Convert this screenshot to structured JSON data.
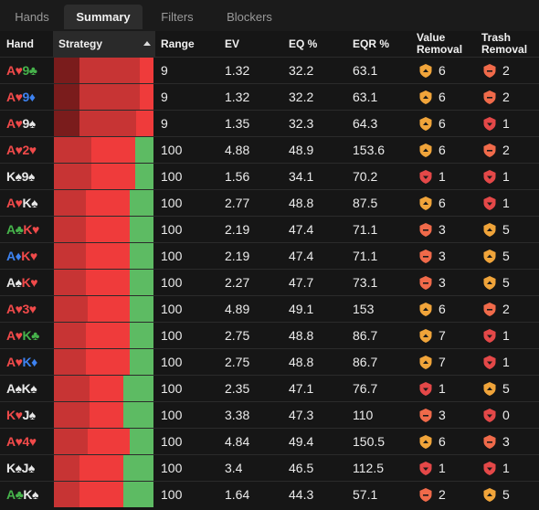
{
  "tabs": [
    "Hands",
    "Summary",
    "Filters",
    "Blockers"
  ],
  "active_tab": 1,
  "columns": {
    "hand": "Hand",
    "strategy": "Strategy",
    "range": "Range",
    "ev": "EV",
    "eq": "EQ %",
    "eqr": "EQR %",
    "value_removal_1": "Value",
    "value_removal_2": "Removal",
    "trash_removal_1": "Trash",
    "trash_removal_2": "Removal"
  },
  "colors": {
    "suit_red": "#f04a4a",
    "suit_white": "#e8e8e8",
    "suit_green": "#46b34b",
    "suit_blue": "#3d82f0",
    "dark_red": "#7a1c1c",
    "mid_red": "#c73434",
    "red": "#ef3b3b",
    "green": "#5dbb63",
    "badge_orange": "#f0a43a",
    "badge_red": "#e44848",
    "badge_coral": "#f06a4a"
  },
  "rows": [
    {
      "hand": [
        {
          "r": "A",
          "s": "♥",
          "c": "suit_red"
        },
        {
          "r": "9",
          "s": "♣",
          "c": "suit_green"
        }
      ],
      "strategy": [
        {
          "color": "dark_red",
          "frac": 0.26
        },
        {
          "color": "mid_red",
          "frac": 0.6
        },
        {
          "color": "red",
          "frac": 0.14
        }
      ],
      "range": "9",
      "ev": "1.32",
      "eq": "32.2",
      "eqr": "63.1",
      "vr": {
        "icon": "badge_orange",
        "val": "6"
      },
      "tr": {
        "icon": "badge_coral",
        "val": "2"
      }
    },
    {
      "hand": [
        {
          "r": "A",
          "s": "♥",
          "c": "suit_red"
        },
        {
          "r": "9",
          "s": "♦",
          "c": "suit_blue"
        }
      ],
      "strategy": [
        {
          "color": "dark_red",
          "frac": 0.26
        },
        {
          "color": "mid_red",
          "frac": 0.6
        },
        {
          "color": "red",
          "frac": 0.14
        }
      ],
      "range": "9",
      "ev": "1.32",
      "eq": "32.2",
      "eqr": "63.1",
      "vr": {
        "icon": "badge_orange",
        "val": "6"
      },
      "tr": {
        "icon": "badge_coral",
        "val": "2"
      }
    },
    {
      "hand": [
        {
          "r": "A",
          "s": "♥",
          "c": "suit_red"
        },
        {
          "r": "9",
          "s": "♠",
          "c": "suit_white"
        }
      ],
      "strategy": [
        {
          "color": "dark_red",
          "frac": 0.26
        },
        {
          "color": "mid_red",
          "frac": 0.57
        },
        {
          "color": "red",
          "frac": 0.17
        }
      ],
      "range": "9",
      "ev": "1.35",
      "eq": "32.3",
      "eqr": "64.3",
      "vr": {
        "icon": "badge_orange",
        "val": "6"
      },
      "tr": {
        "icon": "badge_red",
        "val": "1"
      }
    },
    {
      "hand": [
        {
          "r": "A",
          "s": "♥",
          "c": "suit_red"
        },
        {
          "r": "2",
          "s": "♥",
          "c": "suit_red"
        }
      ],
      "strategy": [
        {
          "color": "mid_red",
          "frac": 0.38
        },
        {
          "color": "red",
          "frac": 0.44
        },
        {
          "color": "green",
          "frac": 0.18
        }
      ],
      "range": "100",
      "ev": "4.88",
      "eq": "48.9",
      "eqr": "153.6",
      "vr": {
        "icon": "badge_orange",
        "val": "6"
      },
      "tr": {
        "icon": "badge_coral",
        "val": "2"
      }
    },
    {
      "hand": [
        {
          "r": "K",
          "s": "♠",
          "c": "suit_white"
        },
        {
          "r": "9",
          "s": "♠",
          "c": "suit_white"
        }
      ],
      "strategy": [
        {
          "color": "mid_red",
          "frac": 0.38
        },
        {
          "color": "red",
          "frac": 0.44
        },
        {
          "color": "green",
          "frac": 0.18
        }
      ],
      "range": "100",
      "ev": "1.56",
      "eq": "34.1",
      "eqr": "70.2",
      "vr": {
        "icon": "badge_red",
        "val": "1"
      },
      "tr": {
        "icon": "badge_red",
        "val": "1"
      }
    },
    {
      "hand": [
        {
          "r": "A",
          "s": "♥",
          "c": "suit_red"
        },
        {
          "r": "K",
          "s": "♠",
          "c": "suit_white"
        }
      ],
      "strategy": [
        {
          "color": "mid_red",
          "frac": 0.32
        },
        {
          "color": "red",
          "frac": 0.44
        },
        {
          "color": "green",
          "frac": 0.24
        }
      ],
      "range": "100",
      "ev": "2.77",
      "eq": "48.8",
      "eqr": "87.5",
      "vr": {
        "icon": "badge_orange",
        "val": "6"
      },
      "tr": {
        "icon": "badge_red",
        "val": "1"
      }
    },
    {
      "hand": [
        {
          "r": "A",
          "s": "♣",
          "c": "suit_green"
        },
        {
          "r": "K",
          "s": "♥",
          "c": "suit_red"
        }
      ],
      "strategy": [
        {
          "color": "mid_red",
          "frac": 0.32
        },
        {
          "color": "red",
          "frac": 0.44
        },
        {
          "color": "green",
          "frac": 0.24
        }
      ],
      "range": "100",
      "ev": "2.19",
      "eq": "47.4",
      "eqr": "71.1",
      "vr": {
        "icon": "badge_coral",
        "val": "3"
      },
      "tr": {
        "icon": "badge_orange",
        "val": "5"
      }
    },
    {
      "hand": [
        {
          "r": "A",
          "s": "♦",
          "c": "suit_blue"
        },
        {
          "r": "K",
          "s": "♥",
          "c": "suit_red"
        }
      ],
      "strategy": [
        {
          "color": "mid_red",
          "frac": 0.32
        },
        {
          "color": "red",
          "frac": 0.44
        },
        {
          "color": "green",
          "frac": 0.24
        }
      ],
      "range": "100",
      "ev": "2.19",
      "eq": "47.4",
      "eqr": "71.1",
      "vr": {
        "icon": "badge_coral",
        "val": "3"
      },
      "tr": {
        "icon": "badge_orange",
        "val": "5"
      }
    },
    {
      "hand": [
        {
          "r": "A",
          "s": "♠",
          "c": "suit_white"
        },
        {
          "r": "K",
          "s": "♥",
          "c": "suit_red"
        }
      ],
      "strategy": [
        {
          "color": "mid_red",
          "frac": 0.32
        },
        {
          "color": "red",
          "frac": 0.44
        },
        {
          "color": "green",
          "frac": 0.24
        }
      ],
      "range": "100",
      "ev": "2.27",
      "eq": "47.7",
      "eqr": "73.1",
      "vr": {
        "icon": "badge_coral",
        "val": "3"
      },
      "tr": {
        "icon": "badge_orange",
        "val": "5"
      }
    },
    {
      "hand": [
        {
          "r": "A",
          "s": "♥",
          "c": "suit_red"
        },
        {
          "r": "3",
          "s": "♥",
          "c": "suit_red"
        }
      ],
      "strategy": [
        {
          "color": "mid_red",
          "frac": 0.34
        },
        {
          "color": "red",
          "frac": 0.42
        },
        {
          "color": "green",
          "frac": 0.24
        }
      ],
      "range": "100",
      "ev": "4.89",
      "eq": "49.1",
      "eqr": "153",
      "vr": {
        "icon": "badge_orange",
        "val": "6"
      },
      "tr": {
        "icon": "badge_coral",
        "val": "2"
      }
    },
    {
      "hand": [
        {
          "r": "A",
          "s": "♥",
          "c": "suit_red"
        },
        {
          "r": "K",
          "s": "♣",
          "c": "suit_green"
        }
      ],
      "strategy": [
        {
          "color": "mid_red",
          "frac": 0.32
        },
        {
          "color": "red",
          "frac": 0.44
        },
        {
          "color": "green",
          "frac": 0.24
        }
      ],
      "range": "100",
      "ev": "2.75",
      "eq": "48.8",
      "eqr": "86.7",
      "vr": {
        "icon": "badge_orange",
        "val": "7"
      },
      "tr": {
        "icon": "badge_red",
        "val": "1"
      }
    },
    {
      "hand": [
        {
          "r": "A",
          "s": "♥",
          "c": "suit_red"
        },
        {
          "r": "K",
          "s": "♦",
          "c": "suit_blue"
        }
      ],
      "strategy": [
        {
          "color": "mid_red",
          "frac": 0.32
        },
        {
          "color": "red",
          "frac": 0.44
        },
        {
          "color": "green",
          "frac": 0.24
        }
      ],
      "range": "100",
      "ev": "2.75",
      "eq": "48.8",
      "eqr": "86.7",
      "vr": {
        "icon": "badge_orange",
        "val": "7"
      },
      "tr": {
        "icon": "badge_red",
        "val": "1"
      }
    },
    {
      "hand": [
        {
          "r": "A",
          "s": "♠",
          "c": "suit_white"
        },
        {
          "r": "K",
          "s": "♠",
          "c": "suit_white"
        }
      ],
      "strategy": [
        {
          "color": "mid_red",
          "frac": 0.36
        },
        {
          "color": "red",
          "frac": 0.34
        },
        {
          "color": "green",
          "frac": 0.3
        }
      ],
      "range": "100",
      "ev": "2.35",
      "eq": "47.1",
      "eqr": "76.7",
      "vr": {
        "icon": "badge_red",
        "val": "1"
      },
      "tr": {
        "icon": "badge_orange",
        "val": "5"
      }
    },
    {
      "hand": [
        {
          "r": "K",
          "s": "♥",
          "c": "suit_red"
        },
        {
          "r": "J",
          "s": "♠",
          "c": "suit_white"
        }
      ],
      "strategy": [
        {
          "color": "mid_red",
          "frac": 0.36
        },
        {
          "color": "red",
          "frac": 0.34
        },
        {
          "color": "green",
          "frac": 0.3
        }
      ],
      "range": "100",
      "ev": "3.38",
      "eq": "47.3",
      "eqr": "110",
      "vr": {
        "icon": "badge_coral",
        "val": "3"
      },
      "tr": {
        "icon": "badge_red",
        "val": "0"
      }
    },
    {
      "hand": [
        {
          "r": "A",
          "s": "♥",
          "c": "suit_red"
        },
        {
          "r": "4",
          "s": "♥",
          "c": "suit_red"
        }
      ],
      "strategy": [
        {
          "color": "mid_red",
          "frac": 0.34
        },
        {
          "color": "red",
          "frac": 0.42
        },
        {
          "color": "green",
          "frac": 0.24
        }
      ],
      "range": "100",
      "ev": "4.84",
      "eq": "49.4",
      "eqr": "150.5",
      "vr": {
        "icon": "badge_orange",
        "val": "6"
      },
      "tr": {
        "icon": "badge_coral",
        "val": "3"
      }
    },
    {
      "hand": [
        {
          "r": "K",
          "s": "♠",
          "c": "suit_white"
        },
        {
          "r": "J",
          "s": "♠",
          "c": "suit_white"
        }
      ],
      "strategy": [
        {
          "color": "mid_red",
          "frac": 0.26
        },
        {
          "color": "red",
          "frac": 0.44
        },
        {
          "color": "green",
          "frac": 0.3
        }
      ],
      "range": "100",
      "ev": "3.4",
      "eq": "46.5",
      "eqr": "112.5",
      "vr": {
        "icon": "badge_red",
        "val": "1"
      },
      "tr": {
        "icon": "badge_red",
        "val": "1"
      }
    },
    {
      "hand": [
        {
          "r": "A",
          "s": "♣",
          "c": "suit_green"
        },
        {
          "r": "K",
          "s": "♠",
          "c": "suit_white"
        }
      ],
      "strategy": [
        {
          "color": "mid_red",
          "frac": 0.26
        },
        {
          "color": "red",
          "frac": 0.44
        },
        {
          "color": "green",
          "frac": 0.3
        }
      ],
      "range": "100",
      "ev": "1.64",
      "eq": "44.3",
      "eqr": "57.1",
      "vr": {
        "icon": "badge_coral",
        "val": "2"
      },
      "tr": {
        "icon": "badge_orange",
        "val": "5"
      }
    }
  ]
}
